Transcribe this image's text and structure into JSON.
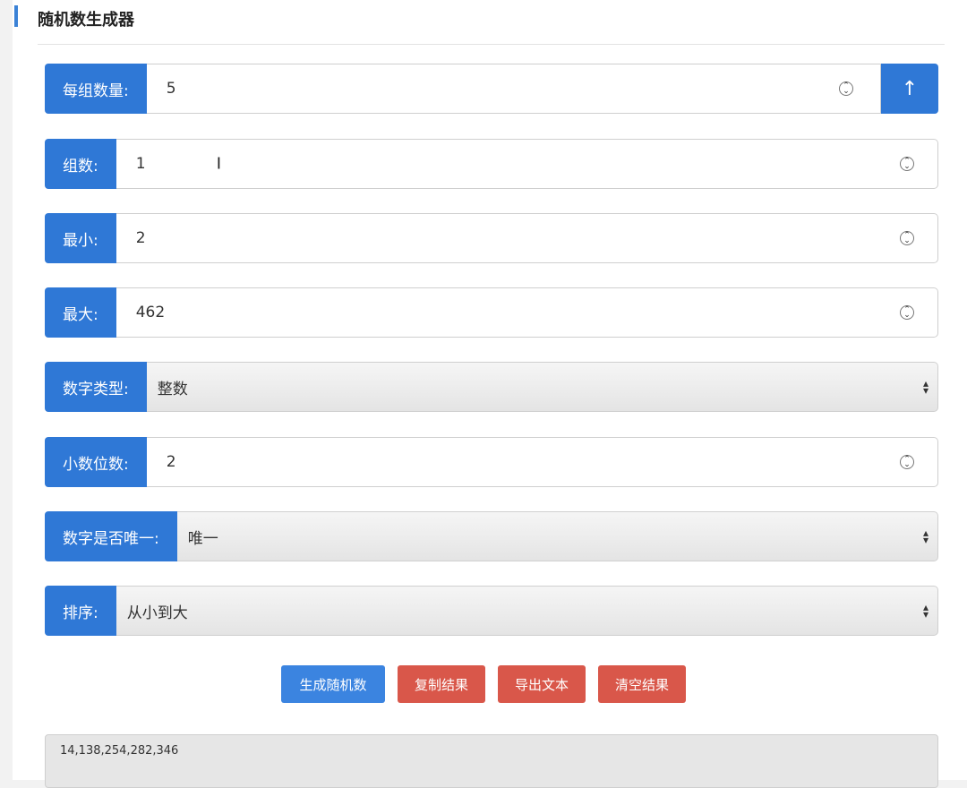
{
  "title": "随机数生成器",
  "fields": [
    {
      "label": "每组数量:",
      "value": "5",
      "kind": "number"
    },
    {
      "label": "组数:",
      "value": "1",
      "kind": "number"
    },
    {
      "label": "最小:",
      "value": "2",
      "kind": "number"
    },
    {
      "label": "最大:",
      "value": "462",
      "kind": "number"
    },
    {
      "label": "数字类型:",
      "value": "整数",
      "kind": "select"
    },
    {
      "label": "小数位数:",
      "value": "2",
      "kind": "number"
    },
    {
      "label": "数字是否唯一:",
      "value": "唯一",
      "kind": "select"
    },
    {
      "label": "排序:",
      "value": "从小到大",
      "kind": "select"
    }
  ],
  "up_button_icon": "arrow-up-icon",
  "up_button_glyph": "↑",
  "buttons": {
    "generate": "生成随机数",
    "copy": "复制结果",
    "export": "导出文本",
    "clear": "清空结果"
  },
  "result": "14,138,254,282,346",
  "colors": {
    "primary": "#2f78d6",
    "danger": "#d9574a"
  }
}
